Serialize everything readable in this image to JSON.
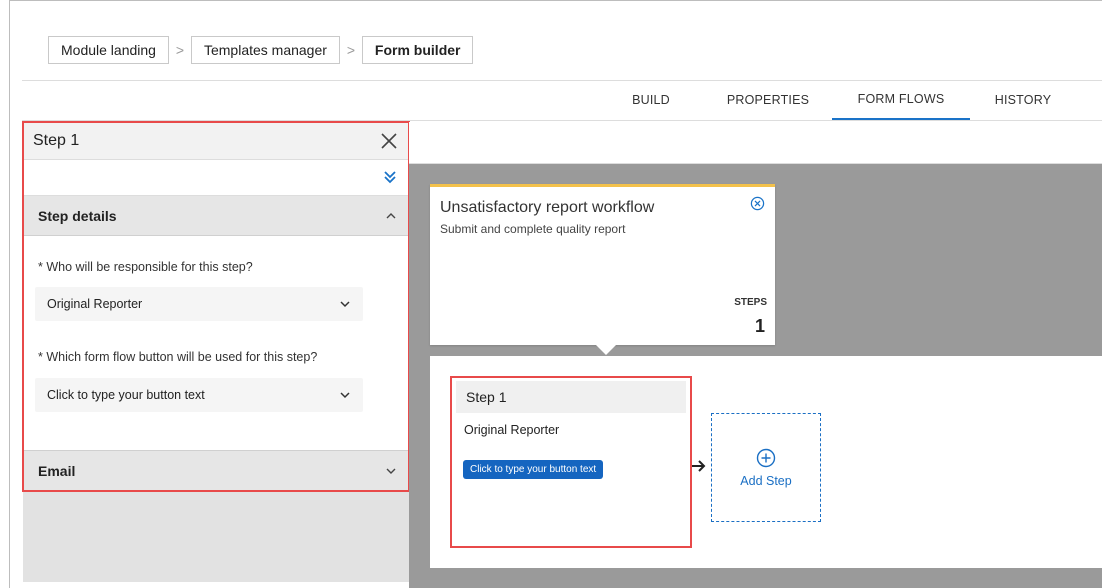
{
  "breadcrumb": {
    "items": [
      "Module landing",
      "Templates manager",
      "Form builder"
    ],
    "separator": ">"
  },
  "tabs": [
    {
      "label": "BUILD",
      "active": false
    },
    {
      "label": "PROPERTIES",
      "active": false
    },
    {
      "label": "FORM FLOWS",
      "active": true
    },
    {
      "label": "HISTORY",
      "active": false
    }
  ],
  "panel": {
    "title": "Step 1",
    "close_icon": "close-icon",
    "expand_icon": "double-chevron-down-icon",
    "step_details": {
      "heading": "Step details",
      "responsible_label": "* Who will be responsible for this step?",
      "responsible_value": "Original Reporter",
      "button_label": "* Which form flow button will be used for this step?",
      "button_value": "Click to type your button text"
    },
    "email": {
      "heading": "Email"
    }
  },
  "workflow": {
    "title": "Unsatisfactory report workflow",
    "subtitle": "Submit and complete quality report",
    "steps_label": "STEPS",
    "steps_count": "1"
  },
  "step_card": {
    "title": "Step 1",
    "assignee": "Original Reporter",
    "button_text": "Click to type your button text"
  },
  "add_step": {
    "label": "Add Step"
  },
  "colors": {
    "accent": "#1a73c8",
    "highlight": "#e84a4a",
    "workflow_bar": "#f3c14b",
    "step_button": "#1565c0"
  }
}
